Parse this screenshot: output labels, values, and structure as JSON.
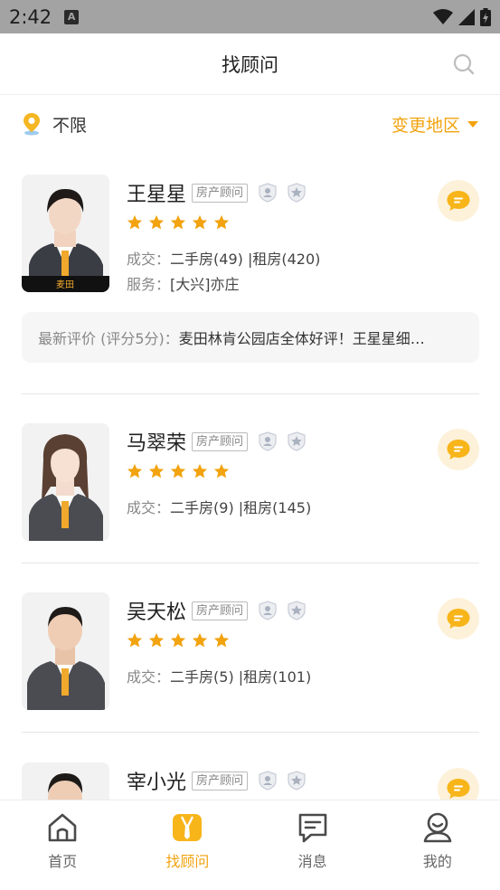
{
  "status_bar": {
    "time": "2:42",
    "notif_letter": "A"
  },
  "header": {
    "title": "找顾问"
  },
  "location": {
    "current": "不限",
    "change_label": "变更地区"
  },
  "advisors": [
    {
      "name": "王星星",
      "role": "房产顾问",
      "rating": 5,
      "deal_label": "成交：",
      "deals": "二手房(49) |租房(420)",
      "service_label": "服务：",
      "service": "[大兴]亦庄",
      "review_label": "最新评价 (评分5分)：",
      "review": "麦田林肯公园店全体好评！王星星细…"
    },
    {
      "name": "马翠荣",
      "role": "房产顾问",
      "rating": 5,
      "deal_label": "成交：",
      "deals": "二手房(9) |租房(145)"
    },
    {
      "name": "吴天松",
      "role": "房产顾问",
      "rating": 5,
      "deal_label": "成交：",
      "deals": "二手房(5) |租房(101)"
    },
    {
      "name": "宰小光",
      "role": "房产顾问",
      "rating": 5
    }
  ],
  "tabs": [
    {
      "label": "首页",
      "icon": "home-icon"
    },
    {
      "label": "找顾问",
      "icon": "advisor-icon",
      "active": true
    },
    {
      "label": "消息",
      "icon": "message-icon"
    },
    {
      "label": "我的",
      "icon": "profile-icon"
    }
  ],
  "colors": {
    "accent": "#f2a30f",
    "status_bar": "#a3a3a3"
  }
}
